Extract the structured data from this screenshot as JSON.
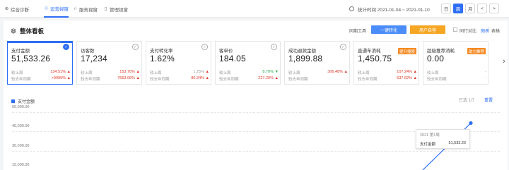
{
  "nav": {
    "items": [
      {
        "label": "综合诊断",
        "icon": "diagnose-icon",
        "active": false
      },
      {
        "label": "运营视窗",
        "icon": "shield-icon",
        "active": true
      },
      {
        "label": "服务视窗",
        "icon": "headset-icon",
        "active": false
      },
      {
        "label": "管理视窗",
        "icon": "clipboard-icon",
        "active": false
      }
    ],
    "stat_time": "统计时间 2021-01-04 ~ 2021-01-10",
    "period_buttons": [
      "日",
      "周",
      "月"
    ],
    "active_period": "周",
    "prev": "<",
    "next": ">"
  },
  "panel": {
    "title": "整体看板",
    "tool_label": "同期工具",
    "tool_btn_1": "一键转化",
    "tool_btn_2": "用户自营",
    "compare_label": "同行对比",
    "view_chart": "图表",
    "view_sep": "|",
    "view_table": "表格"
  },
  "cards": [
    {
      "title": "支付金额",
      "value": "51,533.26",
      "selected": true,
      "badge": "",
      "row1_label": "较上周",
      "row1_value": "134.51%",
      "row1_trend": "up",
      "row2_label": "较去年同期",
      "row2_value": ">9999%",
      "row2_trend": "up"
    },
    {
      "title": "访客数",
      "value": "17,234",
      "selected": false,
      "badge": "",
      "row1_label": "较上周",
      "row1_value": "153.70%",
      "row1_trend": "up",
      "row2_label": "较去年同期",
      "row2_value": "7663.06%",
      "row2_trend": "up"
    },
    {
      "title": "支付转化率",
      "value": "1.62%",
      "selected": false,
      "badge": "",
      "row1_label": "较上周",
      "row1_value": "1.25%",
      "row1_trend": "up-dim",
      "row2_label": "较去年同期",
      "row2_value": "80.34%",
      "row2_trend": "up"
    },
    {
      "title": "客单价",
      "value": "184.05",
      "selected": false,
      "badge": "",
      "row1_label": "较上周",
      "row1_value": "8.70%",
      "row1_trend": "down",
      "row2_label": "较去年同期",
      "row2_value": "227.20%",
      "row2_trend": "up"
    },
    {
      "title": "成功退款金额",
      "value": "1,899.88",
      "selected": false,
      "badge": "",
      "row1_label": "较上周",
      "row1_value": "306.48%",
      "row1_trend": "up",
      "row2_label": "较去年同期",
      "row2_value": "-",
      "row2_trend": "none"
    },
    {
      "title": "直通车消耗",
      "value": "1,450.75",
      "selected": false,
      "badge": "提升搜索",
      "row1_label": "较上周",
      "row1_value": "107.24%",
      "row1_trend": "up",
      "row2_label": "较去年同期",
      "row2_value": "637.62%",
      "row2_trend": "up"
    },
    {
      "title": "超级推荐消耗",
      "value": "0.00",
      "selected": false,
      "badge": "助力推荐",
      "row1_label": "较上周",
      "row1_value": "-",
      "row1_trend": "none",
      "row2_label": "较去年同期",
      "row2_value": "-",
      "row2_trend": "none"
    }
  ],
  "chart_data": {
    "type": "line",
    "legend": "支付金额",
    "selected_count": "已选 1/7",
    "reset_label": "重置",
    "y_ticks": [
      "60,000.00",
      "45,000.00",
      "30,000.00",
      "15,000.00"
    ],
    "ylim": [
      0,
      60000
    ],
    "series": [
      {
        "name": "支付金额",
        "color": "#2e6ef5",
        "points": [
          {
            "x": "2021 第1周",
            "y": 51533.26
          }
        ]
      }
    ],
    "tooltip": {
      "header": "2021 第1周",
      "key": "支付金额",
      "value": "51,533.26"
    }
  }
}
